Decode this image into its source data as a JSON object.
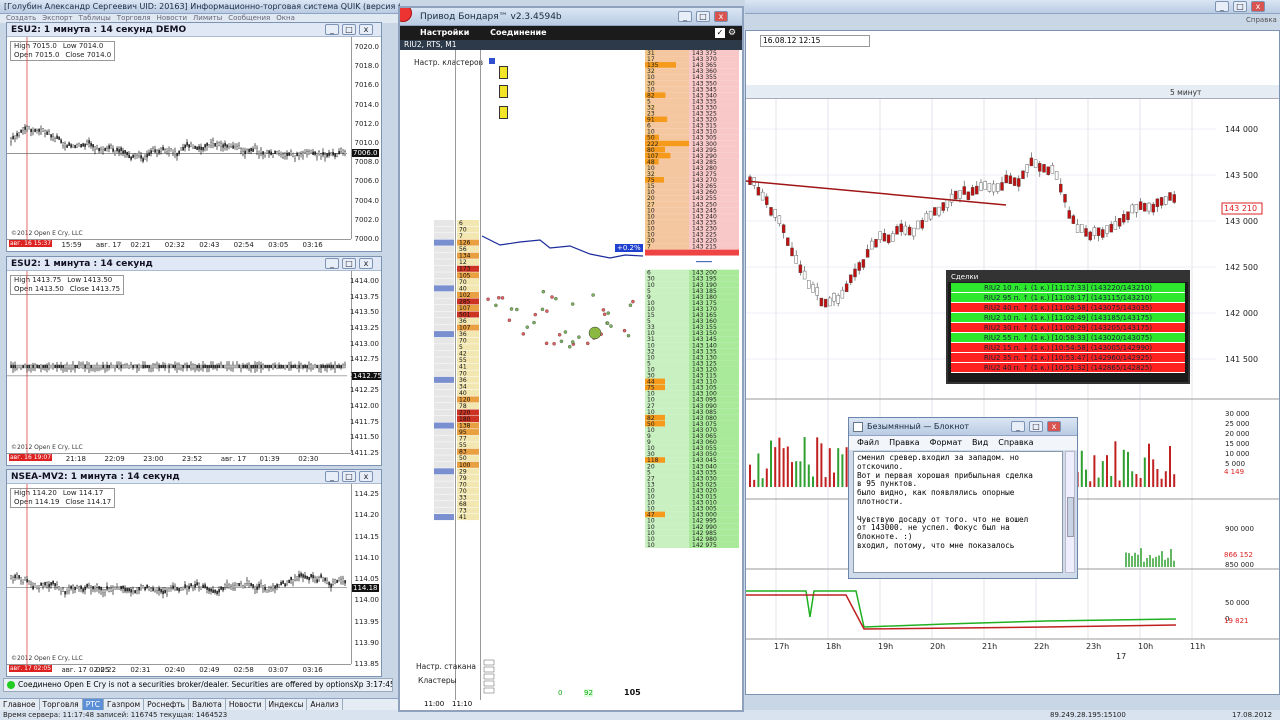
{
  "app": {
    "main_title": "[Голубин Александр Сергеевич  UID: 20163] Информационно-торговая система QUIK (версия 6.02.0.39)",
    "menu_items": [
      "Создать",
      "Экспорт",
      "Таблицы",
      "Торговля",
      "Новости",
      "Лимиты",
      "Сообщения",
      "Окна"
    ],
    "help_label": "Справка"
  },
  "charts": [
    {
      "title": "ESU2: 1 минута : 14 секунд DEMO",
      "ohlc": {
        "high": "High  7015.0",
        "low": "Low  7014.0",
        "open": "Open  7015.0",
        "close": "Close  7014.0"
      },
      "yticks": [
        "7020.0",
        "7018.0",
        "7016.0",
        "7014.0",
        "7012.0",
        "7010.0",
        "7008.0",
        "7006.0",
        "7004.0",
        "7002.0",
        "7000.0"
      ],
      "price_label": "7006.0",
      "xticks": [
        "15:48",
        "15:59",
        "авг. 17",
        "02:21",
        "02:32",
        "02:43",
        "02:54",
        "03:05",
        "03:16"
      ],
      "cursor_time": "авг. 16 15:37",
      "copyright": "©2012 Open E Cry, LLC"
    },
    {
      "title": "ESU2: 1 минута : 14 секунд",
      "ohlc": {
        "high": "High  1413.75",
        "low": "Low  1413.50",
        "open": "Open  1413.50",
        "close": "Close  1413.75"
      },
      "yticks": [
        "1414.00",
        "1413.75",
        "1413.50",
        "1413.25",
        "1413.00",
        "1412.75",
        "1412.50",
        "1412.25",
        "1412.00",
        "1411.75",
        "1411.50",
        "1411.25"
      ],
      "price_label": "1412.75",
      "xticks": [
        "20:26",
        "21:18",
        "22:09",
        "23:00",
        "23:52",
        "авг. 17",
        "01:39",
        "02:30"
      ],
      "cursor_time": "авг. 16 19:07",
      "copyright": "©2012 Open E Cry, LLC"
    },
    {
      "title": "NSEA-MV2: 1 минута : 14 секунд",
      "ohlc": {
        "high": "High  114.20",
        "low": "Low  114.17",
        "open": "Open  114.19",
        "close": "Close  114.17"
      },
      "yticks": [
        "114.25",
        "114.20",
        "114.15",
        "114.10",
        "114.05",
        "114.00",
        "113.95",
        "113.90",
        "113.85"
      ],
      "price_label": "114.18",
      "xticks": [
        "01:43",
        "авг. 17 02:05",
        "02:22",
        "02:31",
        "02:40",
        "02:49",
        "02:58",
        "03:07",
        "03:16"
      ],
      "cursor_time": "авг. 17 02:05",
      "copyright": "©2012 Open E Cry, LLC"
    }
  ],
  "status_connected": "Соединено    Open E Cry is not a securities broker/dealer. Securities are offered by optionsXp 3:17:45",
  "tabs": [
    "Главное",
    "Торговля",
    "РТС",
    "Газпром",
    "Роснефть",
    "Валюта",
    "Новости",
    "Индексы",
    "Анализ"
  ],
  "active_tab": "РТС",
  "bottom_status": {
    "left": "Время сервера: 11:17:48  записей: 116745  текущая: 1464523",
    "ip": "89.249.28.195:15100",
    "date": "17.08.2012"
  },
  "ladder": {
    "window_title": "Привод Бондаря™ v2.3.4594b",
    "menu_settings": "Настройки",
    "menu_connection": "Соединение",
    "instrument": "RIU2, RTS, M1",
    "cluster_settings": "Настр. кластеров",
    "stakan_settings": "Настр. стакана",
    "clusters_label": "Кластеры",
    "time_from": "11:00",
    "time_to": "11:10",
    "percent_badge": "+0.2%",
    "bottom_values": [
      "0",
      "92",
      "105"
    ],
    "ask_prices": [
      "143 375",
      "143 370",
      "143 365",
      "143 360",
      "143 355",
      "143 350",
      "143 345",
      "143 340",
      "143 335",
      "143 330",
      "143 325",
      "143 320",
      "143 315",
      "143 310",
      "143 305",
      "143 300",
      "143 295",
      "143 290",
      "143 285",
      "143 280",
      "143 275",
      "143 270",
      "143 265",
      "143 260",
      "143 255",
      "143 250",
      "143 245",
      "143 240",
      "143 235",
      "143 230",
      "143 225",
      "143 220",
      "143 215"
    ],
    "ask_sizes": [
      "31",
      "17",
      "135",
      "32",
      "10",
      "30",
      "10",
      "82",
      "5",
      "32",
      "23",
      "91",
      "6",
      "10",
      "50",
      "222",
      "80",
      "107",
      "48",
      "10",
      "32",
      "75",
      "15",
      "10",
      "20",
      "27",
      "10",
      "10",
      "10",
      "10",
      "10",
      "20",
      "7"
    ],
    "bid_prices": [
      "143 200",
      "143 195",
      "143 190",
      "143 185",
      "143 180",
      "143 175",
      "143 170",
      "143 165",
      "143 160",
      "143 155",
      "143 150",
      "143 145",
      "143 140",
      "143 135",
      "143 130",
      "143 125",
      "143 120",
      "143 115",
      "143 110",
      "143 105",
      "143 100",
      "143 095",
      "143 090",
      "143 085",
      "143 080",
      "143 075",
      "143 070",
      "143 065",
      "143 060",
      "143 055",
      "143 050",
      "143 045",
      "143 040",
      "143 035",
      "143 030",
      "143 025",
      "143 020",
      "143 015",
      "143 010",
      "143 005",
      "143 000",
      "142 995",
      "142 990",
      "142 985",
      "142 980",
      "142 975"
    ],
    "bid_sizes": [
      "6",
      "30",
      "10",
      "5",
      "9",
      "10",
      "10",
      "15",
      "5",
      "33",
      "10",
      "31",
      "10",
      "32",
      "10",
      "5",
      "10",
      "30",
      "44",
      "75",
      "10",
      "10",
      "27",
      "10",
      "82",
      "50",
      "10",
      "9",
      "9",
      "10",
      "30",
      "118",
      "20",
      "5",
      "27",
      "13",
      "10",
      "10",
      "10",
      "10",
      "47",
      "10",
      "10",
      "10",
      "10",
      "10"
    ],
    "cluster_volumes": [
      "6",
      "70",
      "7",
      "126",
      "56",
      "134",
      "12",
      "173",
      "105",
      "70",
      "40",
      "102",
      "285",
      "107",
      "501",
      "36",
      "107",
      "36",
      "70",
      "5",
      "42",
      "55",
      "41",
      "70",
      "36",
      "34",
      "40",
      "120",
      "78",
      "220",
      "180",
      "138",
      "95",
      "77",
      "55",
      "83",
      "50",
      "100",
      "29",
      "79",
      "70",
      "70",
      "33",
      "68",
      "73",
      "41"
    ]
  },
  "right_chart": {
    "date_box": "16.08.12 12:15",
    "interval_label": "5 минут",
    "price_ticks": [
      "144 000",
      "143 500",
      "143 000",
      "142 500",
      "142 000",
      "141 500"
    ],
    "price_label": "143 210",
    "vol_ticks": [
      "30 000",
      "25 000",
      "20 000",
      "15 000",
      "10 000",
      "5 000"
    ],
    "vol_label": "4 149",
    "oi_ticks": [
      "900 000",
      "850 000"
    ],
    "oi_label": "866 152",
    "third_ticks": [
      "50 000",
      "0"
    ],
    "third_label": "19 821",
    "xticks": [
      "17h",
      "18h",
      "19h",
      "20h",
      "21h",
      "22h",
      "23h",
      "10h",
      "11h"
    ],
    "date_under": "17"
  },
  "deals": {
    "title": "Сделки",
    "rows": [
      {
        "text": "RIU2  10 л. ↓  (1 к.)  [11:17:33]    (143220/143210)",
        "color": "#2ee82e"
      },
      {
        "text": "RIU2  95 п. ↑  (1 к.)  [11:08:17]    (143115/143210)",
        "color": "#2ee82e"
      },
      {
        "text": "RIU2  40 п. ↑  (1 к.)  [11:04:58]    (143075/143035)",
        "color": "#ff2020"
      },
      {
        "text": "RIU2  10 п. ↓  (1 к.)  [11:02:49]    (143185/143175)",
        "color": "#2ee82e"
      },
      {
        "text": "RIU2  30 п. ↑  (1 к.)  [11:00:29]    (143205/143175)",
        "color": "#ff2020"
      },
      {
        "text": "RIU2  55 п. ↑  (1 к.)  [10:58:33]    (143020/143075)",
        "color": "#2ee82e"
      },
      {
        "text": "RIU2  15 п. ↓  (1 к.)  [10:54:58]    (143005/142990)",
        "color": "#ff2020"
      },
      {
        "text": "RIU2  35 п. ↑  (1 к.)  [10:53:47]    (142960/142925)",
        "color": "#ff2020"
      },
      {
        "text": "RIU2  40 п. ↑  (1 к.)  [10:51:32]    (142865/142825)",
        "color": "#ff2020"
      }
    ]
  },
  "notepad": {
    "title": "Безымянный — Блокнот",
    "menu": [
      "Файл",
      "Правка",
      "Формат",
      "Вид",
      "Справка"
    ],
    "lines": [
      "сменил сревер.входил за западом. но",
      "отскочило.",
      "Вот и первая хорошая прибыльная сделка",
      "в 95 пунктов.",
      "было видно, как появлялись опорные",
      "плотности.",
      "",
      "Чувствую досаду от того. что не вошел",
      "от 143000. не успел. Фокус был на",
      "блокноте. :)",
      "входил, потому, что мне показалось"
    ]
  }
}
